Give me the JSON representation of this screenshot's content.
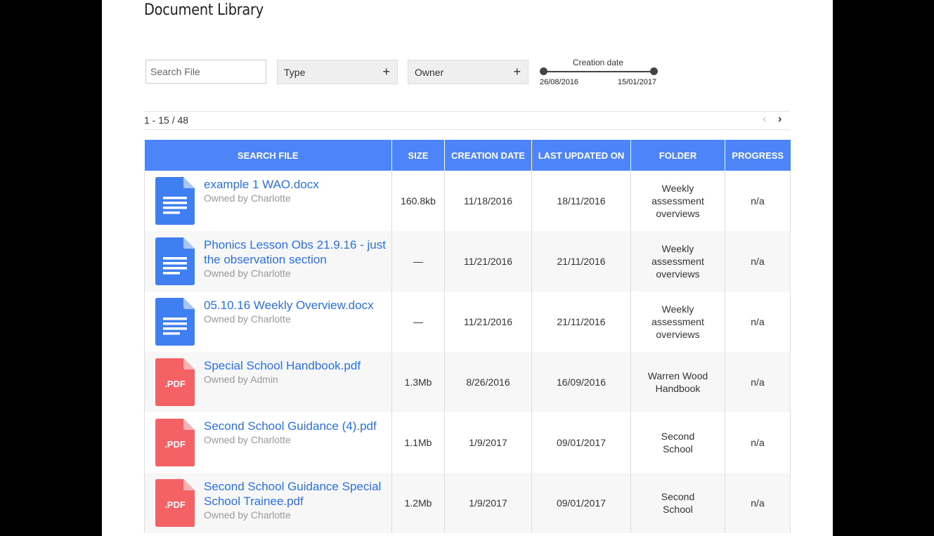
{
  "page": {
    "title": "Document Library"
  },
  "filters": {
    "search_placeholder": "Search File",
    "type_label": "Type",
    "owner_label": "Owner",
    "plus": "+",
    "date": {
      "label": "Creation date",
      "start": "26/08/2016",
      "end": "15/01/2017"
    }
  },
  "pager": {
    "count": "1 - 15 / 48",
    "prev": "‹",
    "next": "›"
  },
  "table": {
    "headers": [
      "SEARCH FILE",
      "SIZE",
      "CREATION DATE",
      "LAST UPDATED ON",
      "FOLDER",
      "PROGRESS"
    ],
    "rows": [
      {
        "icon": "doc",
        "name": "example 1 WAO.docx",
        "owner": "Owned by Charlotte",
        "size": "160.8kb",
        "created": "11/18/2016",
        "updated": "18/11/2016",
        "folder": "Weekly assessment overviews",
        "progress": "n/a"
      },
      {
        "icon": "doc",
        "name": "Phonics Lesson Obs 21.9.16 - just the observation section",
        "owner": "Owned by Charlotte",
        "size": "—",
        "created": "11/21/2016",
        "updated": "21/11/2016",
        "folder": "Weekly assessment overviews",
        "progress": "n/a"
      },
      {
        "icon": "doc",
        "name": "05.10.16 Weekly Overview.docx",
        "owner": "Owned by Charlotte",
        "size": "—",
        "created": "11/21/2016",
        "updated": "21/11/2016",
        "folder": "Weekly assessment overviews",
        "progress": "n/a"
      },
      {
        "icon": "pdf",
        "name": "Special School Handbook.pdf",
        "owner": "Owned by Admin",
        "size": "1.3Mb",
        "created": "8/26/2016",
        "updated": "16/09/2016",
        "folder": "Warren Wood Handbook",
        "progress": "n/a"
      },
      {
        "icon": "pdf",
        "name": "Second School Guidance (4).pdf",
        "owner": "Owned by Charlotte",
        "size": "1.1Mb",
        "created": "1/9/2017",
        "updated": "09/01/2017",
        "folder": "Second School",
        "progress": "n/a"
      },
      {
        "icon": "pdf",
        "name": "Second School Guidance Special School Trainee.pdf",
        "owner": "Owned by Charlotte",
        "size": "1.2Mb",
        "created": "1/9/2017",
        "updated": "09/01/2017",
        "folder": "Second School",
        "progress": "n/a"
      }
    ]
  },
  "icons": {
    "doc": {
      "name": "google-doc-icon",
      "color": "#3f7ff2",
      "fold": "#a9c6fa"
    },
    "pdf": {
      "name": "pdf-file-icon",
      "color": "#f46266",
      "fold": "#f9b1b3",
      "text": ".PDF"
    }
  },
  "colors": {
    "header": "#4d84f7",
    "link": "#2a6ff0"
  }
}
